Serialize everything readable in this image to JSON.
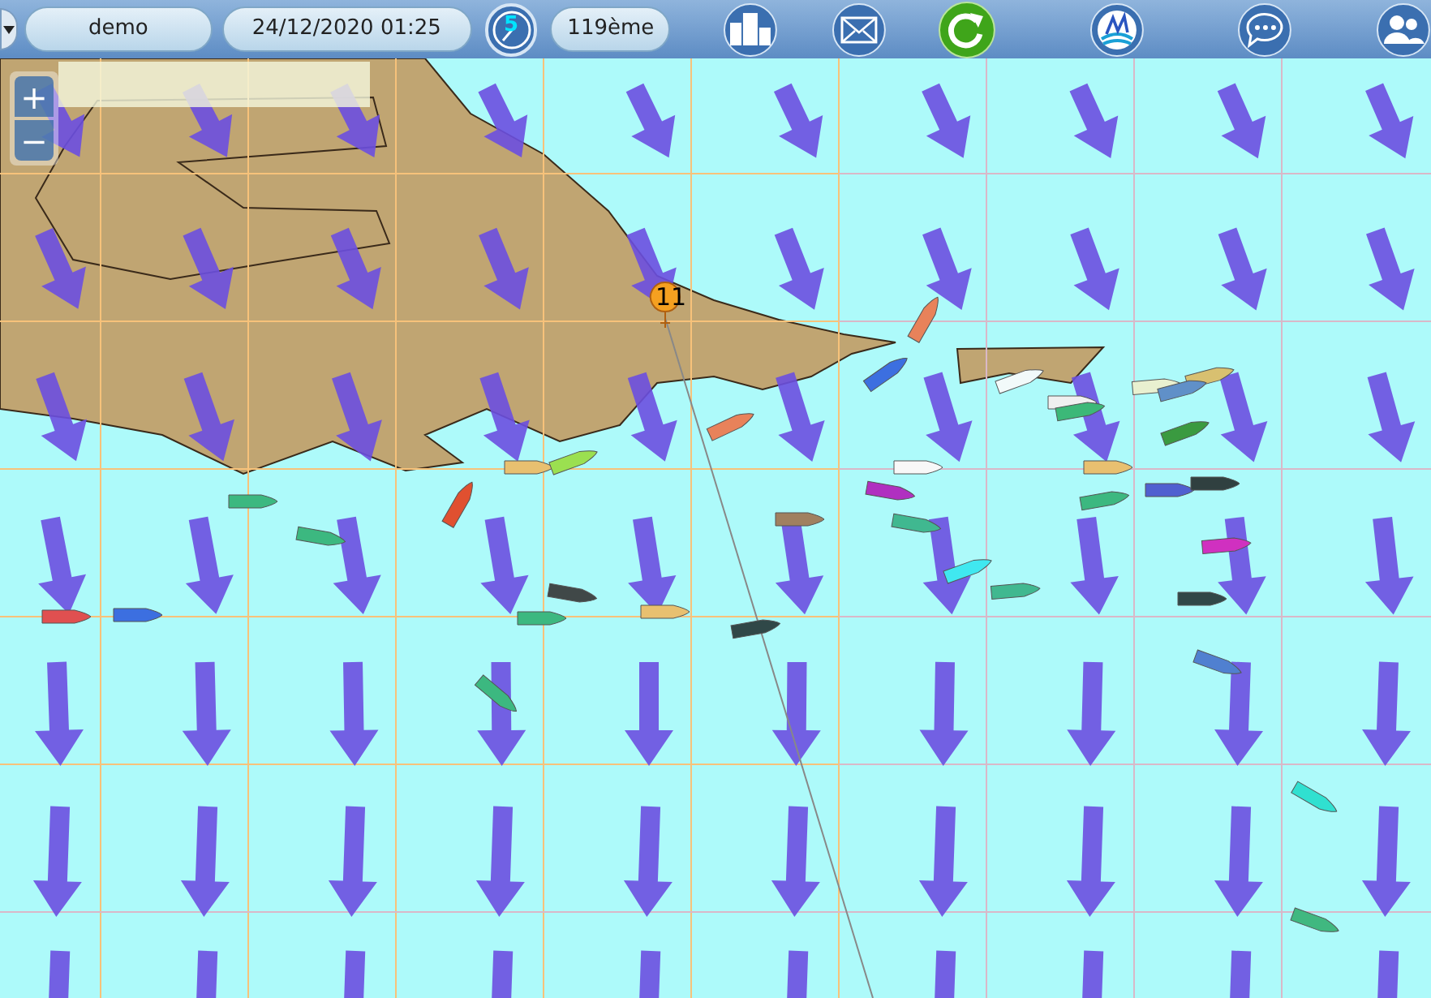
{
  "toolbar": {
    "player_name": "demo",
    "date_time": "24/12/2020 01:25",
    "clock_badge": "5",
    "rank": "119ème"
  },
  "map": {
    "zoom_in": "+",
    "zoom_out": "−",
    "waypoint_label": "11"
  }
}
